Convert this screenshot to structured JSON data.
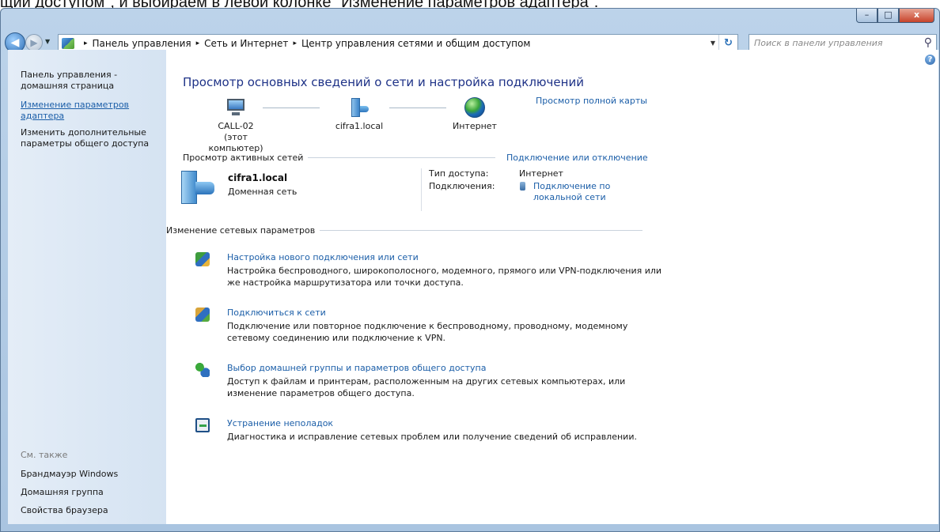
{
  "caption": "щий доступом\", и выбираем в левой колонке \"Изменение параметров адаптера\".",
  "window": {
    "controls": {
      "minimize": "–",
      "maximize": "□",
      "close": "x"
    }
  },
  "nav": {
    "back_icon": "◀",
    "forward_icon": "▶",
    "dropdown": "▼",
    "breadcrumbs": [
      "Панель управления",
      "Сеть и Интернет",
      "Центр управления сетями и общим доступом"
    ],
    "separator": "▸",
    "refresh": "↻",
    "search_placeholder": "Поиск в панели управления",
    "search_icon": "⚲"
  },
  "sidebar": {
    "home": "Панель управления - домашняя страница",
    "adapter": "Изменение параметров адаптера",
    "sharing": "Изменить дополнительные параметры общего доступа",
    "see_also": "См. также",
    "links": [
      "Брандмауэр Windows",
      "Домашняя группа",
      "Свойства браузера"
    ]
  },
  "main": {
    "help": "?",
    "title": "Просмотр основных сведений о сети и настройка подключений",
    "full_map": "Просмотр полной карты",
    "nodes": [
      {
        "name": "CALL-02",
        "sub": "(этот компьютер)"
      },
      {
        "name": "cifra1.local",
        "sub": ""
      },
      {
        "name": "Интернет",
        "sub": ""
      }
    ],
    "active_header": "Просмотр активных сетей",
    "connect_link": "Подключение или отключение",
    "network": {
      "name": "cifra1.local",
      "type": "Доменная сеть",
      "access_label": "Тип доступа:",
      "access_value": "Интернет",
      "conn_label": "Подключения:",
      "conn_value_1": "Подключение по",
      "conn_value_2": "локальной сети"
    },
    "change_header": "Изменение сетевых параметров",
    "tasks": [
      {
        "link": "Настройка нового подключения или сети",
        "desc": "Настройка беспроводного, широкополосного, модемного, прямого или VPN-подключения или же настройка маршрутизатора или точки доступа."
      },
      {
        "link": "Подключиться к сети",
        "desc": "Подключение или повторное подключение к беспроводному, проводному, модемному сетевому соединению или подключение к VPN."
      },
      {
        "link": "Выбор домашней группы и параметров общего доступа",
        "desc": "Доступ к файлам и принтерам, расположенным на других сетевых компьютерах, или изменение параметров общего доступа."
      },
      {
        "link": "Устранение неполадок",
        "desc": "Диагностика и исправление сетевых проблем или получение сведений об исправлении."
      }
    ]
  }
}
